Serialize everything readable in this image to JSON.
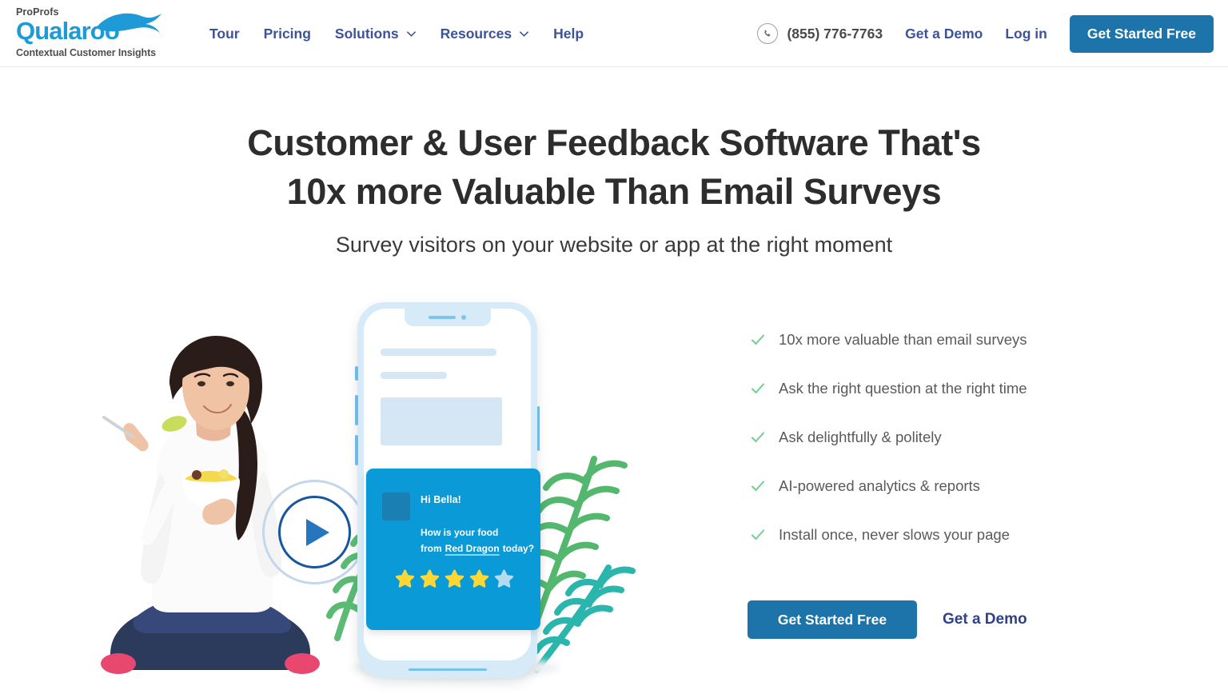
{
  "header": {
    "logo": {
      "top_text": "ProProfs",
      "brand": "Qualaroo",
      "tagline": "Contextual Customer Insights",
      "brand_color": "#1e9ad6",
      "swoosh_icon": "kangaroo-swoosh-icon"
    },
    "nav": [
      {
        "label": "Tour",
        "has_dropdown": false
      },
      {
        "label": "Pricing",
        "has_dropdown": false
      },
      {
        "label": "Solutions",
        "has_dropdown": true
      },
      {
        "label": "Resources",
        "has_dropdown": true
      },
      {
        "label": "Help",
        "has_dropdown": false
      }
    ],
    "phone": {
      "icon": "phone-icon",
      "number": "(855) 776-7763"
    },
    "demo_link": "Get a Demo",
    "login_link": "Log in",
    "cta_label": "Get Started Free",
    "cta_color": "#1d74ab",
    "nav_color": "#3c5398"
  },
  "hero": {
    "title_line1": "Customer & User Feedback Software That's",
    "title_line2": "10x more Valuable Than Email Surveys",
    "subtitle": "Survey visitors on your website or app at the right moment"
  },
  "features": {
    "check_color": "#6fcf8f",
    "items": [
      {
        "label": "10x more valuable than email surveys"
      },
      {
        "label": "Ask the right question at the right time"
      },
      {
        "label": "Ask delightfully & politely"
      },
      {
        "label": "AI-powered analytics & reports"
      },
      {
        "label": "Install once, never slows your page"
      }
    ]
  },
  "cta": {
    "primary_label": "Get Started Free",
    "secondary_label": "Get a Demo",
    "primary_color": "#1d74ab",
    "secondary_color": "#2f4287"
  },
  "illustration": {
    "play_button": {
      "icon": "play-icon",
      "ring_color": "#17569e",
      "outer_ring_color": "#c3d6ec"
    },
    "phone": {
      "frame_color": "#d7eaf7",
      "screen_color": "#ffffff"
    },
    "survey_card": {
      "background": "#0b9ad8",
      "greeting": "Hi Bella!",
      "question_line1": "How is your food",
      "question_line2_prefix": "from",
      "question_brand": "Red Dragon",
      "question_line2_suffix": "today?",
      "underline_color": "#7ddcf5",
      "rating_filled": 4,
      "rating_total": 5,
      "star_filled_color": "#fdd835",
      "star_empty_color": "#b3dcf0"
    },
    "plants": {
      "green_fern_color": "#53b86e",
      "teal_fern_color": "#2ab5ad"
    },
    "person": {
      "description": "woman-eating-salad-photo"
    }
  }
}
